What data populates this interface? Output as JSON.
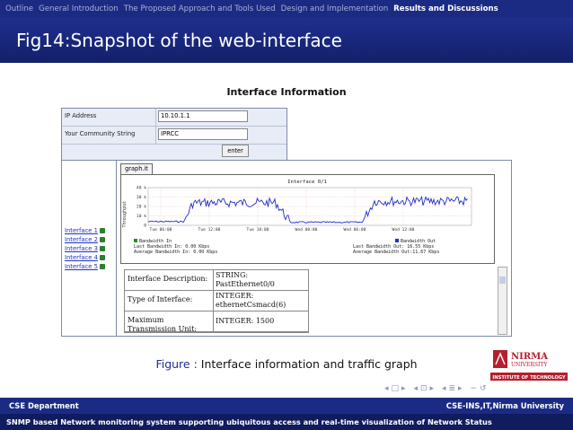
{
  "nav": {
    "items": [
      "Outline",
      "General Introduction",
      "The Proposed Approach and Tools Used",
      "Design and Implementation",
      "Results and Discussions"
    ],
    "active_index": 4
  },
  "slide": {
    "title": "Fig14:Snapshot of the web-interface"
  },
  "figure": {
    "heading": "Interface Information",
    "form": {
      "ip_label": "IP Address",
      "ip_value": "10.10.1.1",
      "community_label": "Your Community String",
      "community_value": "IPRCC",
      "enter_label": "enter"
    },
    "interfaces": [
      "Interface 1",
      "Interface 2",
      "Interface 3",
      "Interface 4",
      "Interface 5"
    ],
    "tab_label": "graph.it",
    "graph": {
      "title": "Interface 0/1",
      "ylabel": "Throughput",
      "yticks": [
        "40 k",
        "30 k",
        "20 k",
        "10 k",
        "0"
      ],
      "xticks": [
        "Tue 06:00",
        "Tue 12:00",
        "Tue 18:00",
        "Wed 00:00",
        "Wed 06:00",
        "Wed 12:00"
      ],
      "legend_in": "Bandwidth In",
      "legend_out": "Bandwidth Out",
      "last_in": "Last Bandwidth In:     0.00 Kbps",
      "avg_in": "Average Bandwidth In:  0.00 Kbps",
      "last_out": "Last Bandwidth Out:   16.55 Kbps",
      "avg_out": "Average Bandwidth Out:11.67 Kbps",
      "in_color": "#2e8b2e",
      "out_color": "#1f2fc9"
    },
    "info": [
      {
        "key": "Interface Description:",
        "value": "STRING: PastEthernet0/0"
      },
      {
        "key": "Type of Interface:",
        "value": "INTEGER: ethernetCsmacd(6)"
      },
      {
        "key": "Maximum Transmission Unit:",
        "value": "INTEGER: 1500"
      }
    ]
  },
  "caption": {
    "label": "Figure :",
    "text": "Interface information and traffic graph"
  },
  "logo": {
    "line1": "NIRMA",
    "line2": "UNIVERSITY",
    "line3": "INSTITUTE OF TECHNOLOGY"
  },
  "footer": {
    "left": "CSE Department",
    "right": "CSE-INS,IT,Nirma University",
    "bottom": "SNMP based Network monitoring system supporting ubiquitous access and real-time visualization of Network Status"
  },
  "colors": {
    "primary": "#1b2b84",
    "accent": "#1f2f8e",
    "logo_red": "#b5202e"
  }
}
